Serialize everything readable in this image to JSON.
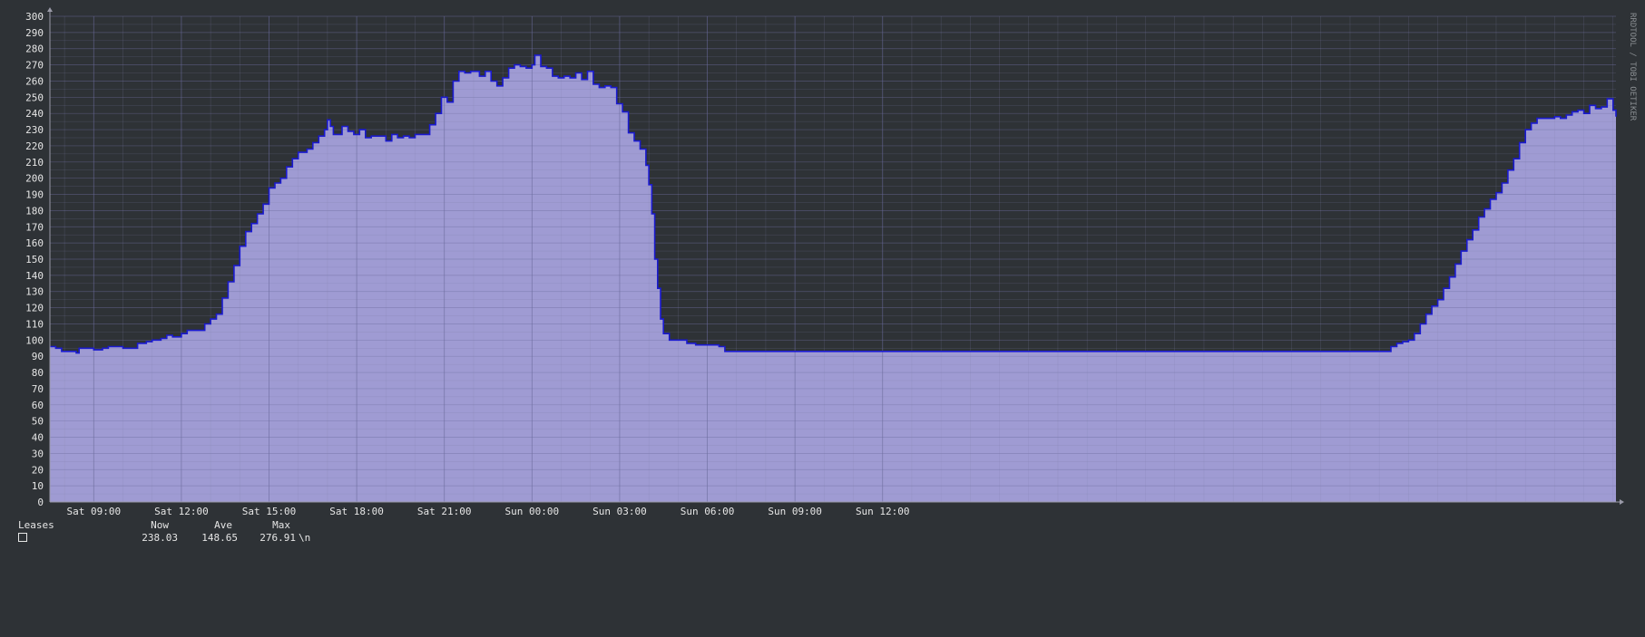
{
  "chart_data": {
    "type": "area",
    "title": "",
    "watermark": "RRDTOOL / TOBI OETIKER",
    "y_ticks": [
      0,
      10,
      20,
      30,
      40,
      50,
      60,
      70,
      80,
      90,
      100,
      110,
      120,
      130,
      140,
      150,
      160,
      170,
      180,
      190,
      200,
      210,
      220,
      230,
      240,
      250,
      260,
      270,
      280,
      290,
      300
    ],
    "ylim": [
      0,
      300
    ],
    "x_ticks": [
      "Sat 09:00",
      "Sat 12:00",
      "Sat 15:00",
      "Sat 18:00",
      "Sat 21:00",
      "Sun 00:00",
      "Sun 03:00",
      "Sun 06:00",
      "Sun 09:00",
      "Sun 12:00"
    ],
    "x_hours_range": [
      7.5,
      38.33
    ],
    "x_tick_hours": [
      9,
      12,
      15,
      18,
      21,
      24,
      27,
      30,
      33,
      36
    ],
    "grid": true,
    "series": [
      {
        "name": "Leases",
        "color": "#1a1ad0",
        "fill": "#9f9bd3",
        "points": [
          [
            7.5,
            96
          ],
          [
            7.7,
            95
          ],
          [
            7.9,
            93
          ],
          [
            8.2,
            93
          ],
          [
            8.4,
            92
          ],
          [
            8.5,
            95
          ],
          [
            8.9,
            95
          ],
          [
            9.0,
            94
          ],
          [
            9.3,
            95
          ],
          [
            9.5,
            96
          ],
          [
            9.8,
            96
          ],
          [
            10.0,
            95
          ],
          [
            10.3,
            95
          ],
          [
            10.5,
            98
          ],
          [
            10.8,
            99
          ],
          [
            11.0,
            100
          ],
          [
            11.3,
            101
          ],
          [
            11.5,
            103
          ],
          [
            11.7,
            102
          ],
          [
            12.0,
            104
          ],
          [
            12.2,
            106
          ],
          [
            12.6,
            106
          ],
          [
            12.8,
            110
          ],
          [
            13.0,
            113
          ],
          [
            13.2,
            116
          ],
          [
            13.4,
            126
          ],
          [
            13.6,
            136
          ],
          [
            13.8,
            146
          ],
          [
            14.0,
            158
          ],
          [
            14.2,
            167
          ],
          [
            14.4,
            172
          ],
          [
            14.6,
            178
          ],
          [
            14.8,
            184
          ],
          [
            15.0,
            194
          ],
          [
            15.2,
            197
          ],
          [
            15.4,
            200
          ],
          [
            15.6,
            207
          ],
          [
            15.8,
            212
          ],
          [
            16.0,
            216
          ],
          [
            16.3,
            218
          ],
          [
            16.5,
            222
          ],
          [
            16.7,
            226
          ],
          [
            16.9,
            230
          ],
          [
            17.0,
            236
          ],
          [
            17.1,
            232
          ],
          [
            17.2,
            227
          ],
          [
            17.4,
            227
          ],
          [
            17.5,
            232
          ],
          [
            17.7,
            229
          ],
          [
            17.9,
            227
          ],
          [
            18.1,
            230
          ],
          [
            18.3,
            225
          ],
          [
            18.5,
            226
          ],
          [
            18.8,
            226
          ],
          [
            19.0,
            223
          ],
          [
            19.2,
            227
          ],
          [
            19.4,
            225
          ],
          [
            19.6,
            226
          ],
          [
            19.8,
            225
          ],
          [
            20.0,
            227
          ],
          [
            20.3,
            227
          ],
          [
            20.5,
            233
          ],
          [
            20.7,
            240
          ],
          [
            20.9,
            250
          ],
          [
            21.1,
            247
          ],
          [
            21.3,
            260
          ],
          [
            21.5,
            266
          ],
          [
            21.7,
            265
          ],
          [
            21.9,
            266
          ],
          [
            22.2,
            263
          ],
          [
            22.4,
            266
          ],
          [
            22.6,
            260
          ],
          [
            22.8,
            257
          ],
          [
            23.0,
            262
          ],
          [
            23.2,
            268
          ],
          [
            23.4,
            270
          ],
          [
            23.6,
            269
          ],
          [
            23.8,
            268
          ],
          [
            24.0,
            270
          ],
          [
            24.1,
            276
          ],
          [
            24.3,
            269
          ],
          [
            24.5,
            268
          ],
          [
            24.7,
            263
          ],
          [
            24.9,
            262
          ],
          [
            25.1,
            263
          ],
          [
            25.3,
            262
          ],
          [
            25.5,
            265
          ],
          [
            25.7,
            261
          ],
          [
            25.9,
            266
          ],
          [
            26.1,
            258
          ],
          [
            26.3,
            256
          ],
          [
            26.5,
            257
          ],
          [
            26.7,
            256
          ],
          [
            26.9,
            246
          ],
          [
            27.1,
            241
          ],
          [
            27.3,
            228
          ],
          [
            27.5,
            223
          ],
          [
            27.7,
            218
          ],
          [
            27.9,
            208
          ],
          [
            28.0,
            196
          ],
          [
            28.1,
            178
          ],
          [
            28.2,
            150
          ],
          [
            28.3,
            132
          ],
          [
            28.4,
            113
          ],
          [
            28.5,
            104
          ],
          [
            28.7,
            100
          ],
          [
            29.0,
            100
          ],
          [
            29.3,
            98
          ],
          [
            29.6,
            97
          ],
          [
            30.0,
            97
          ],
          [
            30.4,
            96
          ],
          [
            30.6,
            93
          ],
          [
            32.0,
            93
          ],
          [
            34.0,
            93
          ],
          [
            36.0,
            93
          ],
          [
            38.0,
            93
          ],
          [
            40.0,
            93
          ],
          [
            42.0,
            93
          ],
          [
            44.0,
            93
          ],
          [
            46.0,
            93
          ],
          [
            48.0,
            93
          ],
          [
            50.0,
            93
          ],
          [
            52.0,
            93
          ],
          [
            53.2,
            93
          ],
          [
            53.4,
            96
          ],
          [
            53.6,
            98
          ],
          [
            53.8,
            99
          ],
          [
            54.0,
            100
          ],
          [
            54.2,
            104
          ],
          [
            54.4,
            110
          ],
          [
            54.6,
            116
          ],
          [
            54.8,
            121
          ],
          [
            55.0,
            125
          ],
          [
            55.2,
            132
          ],
          [
            55.4,
            139
          ],
          [
            55.6,
            147
          ],
          [
            55.8,
            155
          ],
          [
            56.0,
            162
          ],
          [
            56.2,
            168
          ],
          [
            56.4,
            176
          ],
          [
            56.6,
            181
          ],
          [
            56.8,
            187
          ],
          [
            57.0,
            191
          ],
          [
            57.2,
            197
          ],
          [
            57.4,
            205
          ],
          [
            57.6,
            212
          ],
          [
            57.8,
            222
          ],
          [
            58.0,
            230
          ],
          [
            58.2,
            234
          ],
          [
            58.4,
            237
          ],
          [
            58.8,
            237
          ],
          [
            59.0,
            238
          ],
          [
            59.2,
            237
          ],
          [
            59.4,
            239
          ],
          [
            59.6,
            241
          ],
          [
            59.8,
            242
          ],
          [
            60.0,
            240
          ],
          [
            60.2,
            245
          ],
          [
            60.4,
            243
          ],
          [
            60.6,
            244
          ],
          [
            60.8,
            249
          ],
          [
            61.0,
            242
          ],
          [
            61.1,
            238
          ]
        ]
      }
    ],
    "legend": {
      "series_name": "Leases",
      "headers": [
        "Now",
        "Ave",
        "Max"
      ],
      "values": [
        "238.03",
        "148.65",
        "276.91"
      ],
      "trailing": "\\n"
    }
  }
}
